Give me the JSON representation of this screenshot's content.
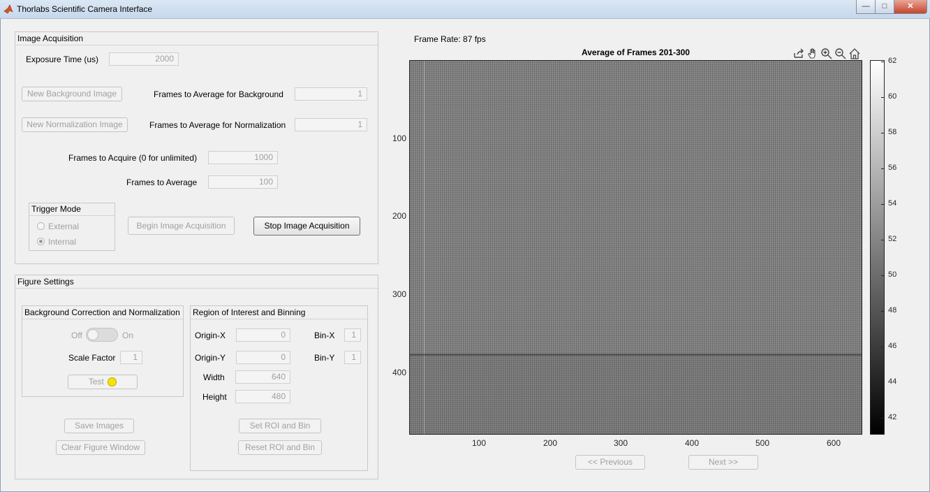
{
  "window": {
    "title": "Thorlabs Scientific Camera Interface",
    "min": "—",
    "max": "□",
    "close": "✕"
  },
  "acquisition": {
    "title": "Image Acquisition",
    "exposure_label": "Exposure Time (us)",
    "exposure_value": "2000",
    "new_bg_btn": "New Background Image",
    "bg_frames_label": "Frames to Average for Background",
    "bg_frames_value": "1",
    "new_norm_btn": "New Normalization Image",
    "norm_frames_label": "Frames to Average for Normalization",
    "norm_frames_value": "1",
    "acquire_label": "Frames to Acquire (0 for unlimited)",
    "acquire_value": "1000",
    "average_label": "Frames to Average",
    "average_value": "100",
    "trigger": {
      "title": "Trigger Mode",
      "external": "External",
      "internal": "Internal",
      "selected": "Internal"
    },
    "begin_btn": "Begin Image Acquisition",
    "stop_btn": "Stop Image Acquisition"
  },
  "figure": {
    "title": "Figure Settings",
    "bgcorr": {
      "title": "Background Correction and Normalization",
      "off": "Off",
      "on": "On",
      "scale_label": "Scale Factor",
      "scale_value": "1",
      "test_btn": "Test",
      "indicator_color": "#f4e400"
    },
    "roi": {
      "title": "Region of Interest and Binning",
      "origin_x_label": "Origin-X",
      "origin_x": "0",
      "bin_x_label": "Bin-X",
      "bin_x": "1",
      "origin_y_label": "Origin-Y",
      "origin_y": "0",
      "bin_y_label": "Bin-Y",
      "bin_y": "1",
      "width_label": "Width",
      "width": "640",
      "height_label": "Height",
      "height": "480",
      "set_btn": "Set ROI and Bin",
      "reset_btn": "Reset ROI and Bin"
    },
    "save_btn": "Save Images",
    "clear_btn": "Clear Figure Window"
  },
  "plot": {
    "frame_rate": "Frame Rate: 87 fps",
    "title": "Average of Frames 201-300",
    "toolbar_icons": [
      "export-icon",
      "pan-icon",
      "zoom-in-icon",
      "zoom-out-icon",
      "home-icon"
    ],
    "x_ticks": [
      "100",
      "200",
      "300",
      "400",
      "500",
      "600"
    ],
    "y_ticks": [
      "100",
      "200",
      "300",
      "400"
    ],
    "colorbar_ticks": [
      "62",
      "60",
      "58",
      "56",
      "54",
      "52",
      "50",
      "48",
      "46",
      "44",
      "42"
    ],
    "prev_btn": "<< Previous",
    "next_btn": "Next >>"
  },
  "chart_data": {
    "type": "heatmap",
    "title": "Average of Frames 201-300",
    "xlim": [
      1,
      640
    ],
    "ylim": [
      1,
      480
    ],
    "x_ticks": [
      100,
      200,
      300,
      400,
      500,
      600
    ],
    "y_ticks": [
      100,
      200,
      300,
      400
    ],
    "colormap": "gray",
    "clim": [
      41,
      62.5
    ],
    "colorbar_ticks": [
      42,
      44,
      46,
      48,
      50,
      52,
      54,
      56,
      58,
      60,
      62
    ]
  }
}
